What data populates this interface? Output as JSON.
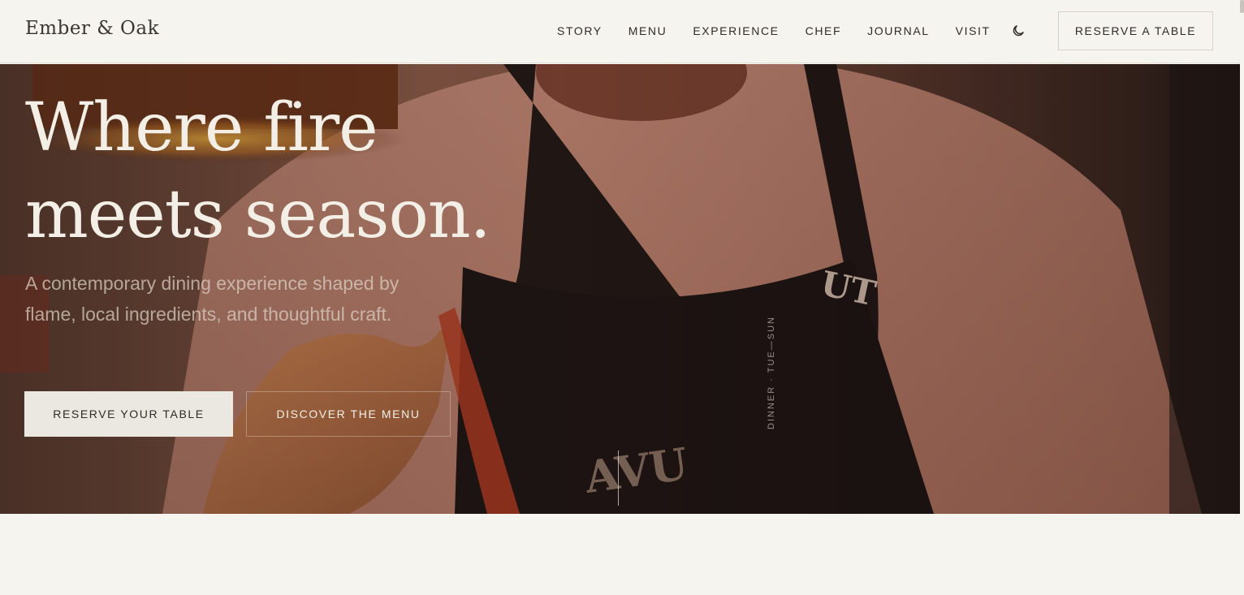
{
  "brand": {
    "name": "Ember & Oak"
  },
  "nav": {
    "items": [
      {
        "label": "STORY"
      },
      {
        "label": "MENU"
      },
      {
        "label": "EXPERIENCE"
      },
      {
        "label": "CHEF"
      },
      {
        "label": "JOURNAL"
      },
      {
        "label": "VISIT"
      }
    ],
    "theme_icon": "moon-icon",
    "reserve_label": "RESERVE A TABLE"
  },
  "hero": {
    "headline_line1": "Where fire",
    "headline_line2": "meets season.",
    "subtitle": "A contemporary dining experience shaped by flame, local ingredients, and thoughtful craft.",
    "primary_cta": "RESERVE YOUR TABLE",
    "secondary_cta": "DISCOVER THE MENU",
    "vertical_label": "DINNER · TUE—SUN"
  },
  "colors": {
    "background": "#f6f4ef",
    "text": "#2f2b28",
    "hero_text": "#f3eee6",
    "button_light": "#ebe8e2"
  }
}
